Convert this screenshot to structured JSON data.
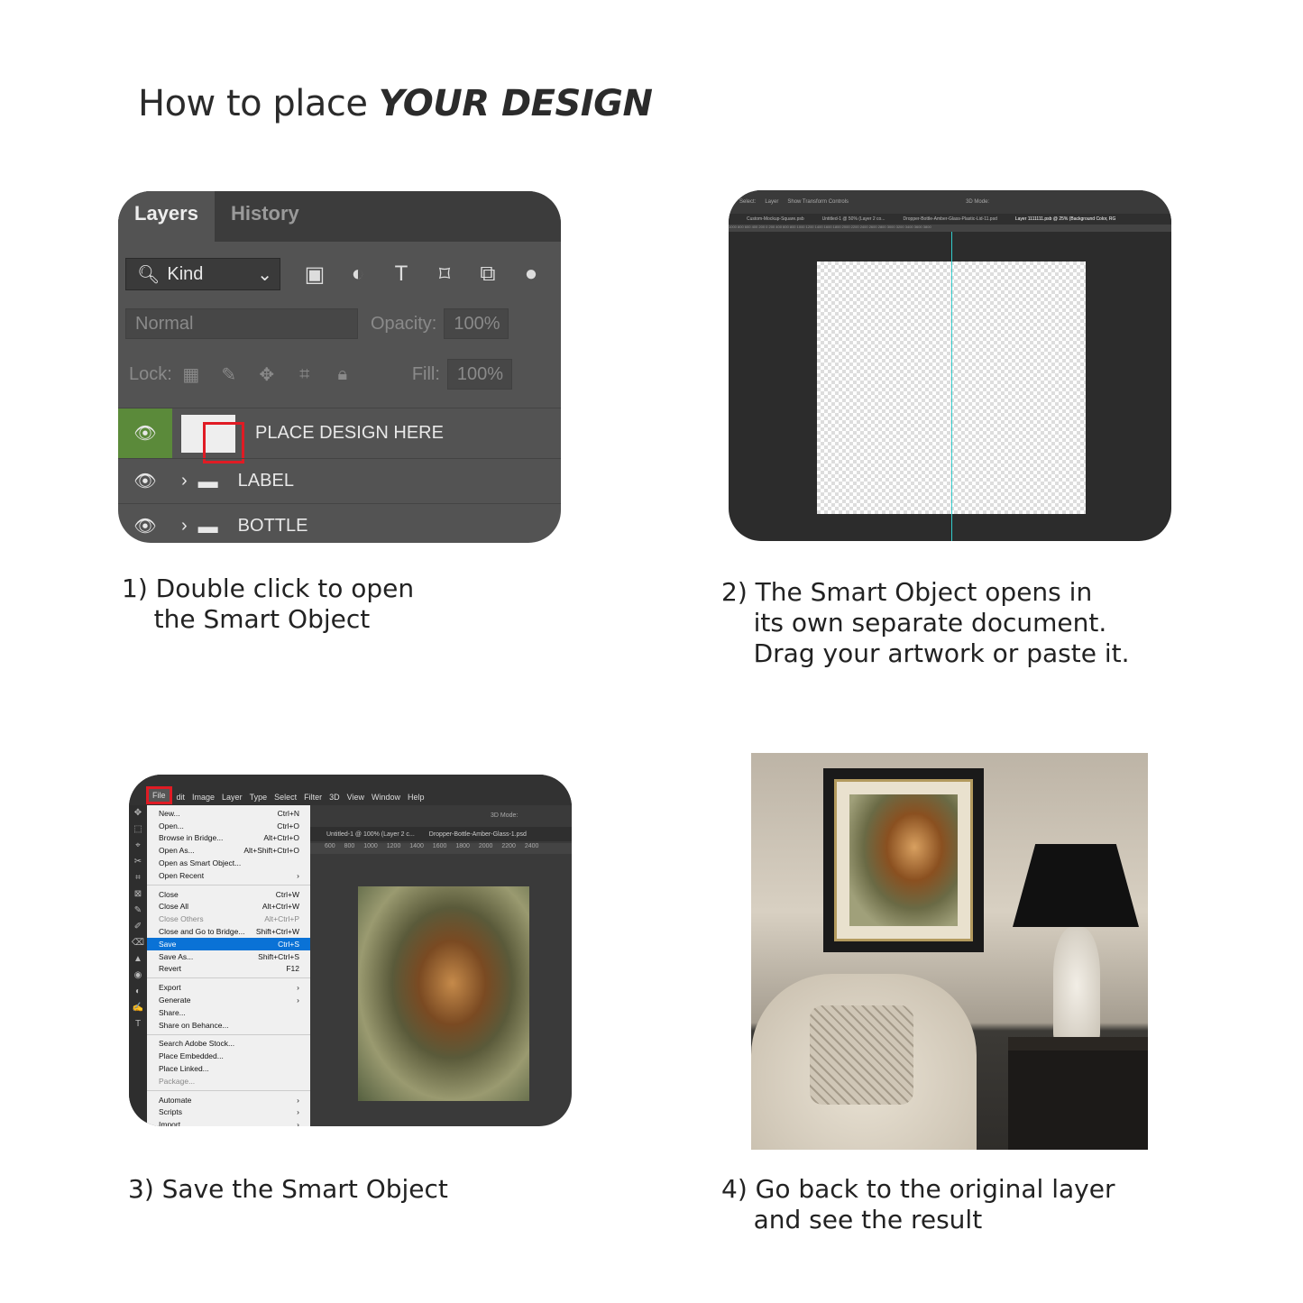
{
  "title": {
    "normal": "How to place ",
    "bold": "YOUR DESIGN"
  },
  "step1": {
    "caption": "1) Double click to open\n    the Smart Object",
    "tabs": [
      "Layers",
      "History"
    ],
    "filter_kind": "Kind",
    "blend_mode": "Normal",
    "opacity_label": "Opacity:",
    "opacity_value": "100%",
    "lock_label": "Lock:",
    "fill_label": "Fill:",
    "fill_value": "100%",
    "layers": [
      {
        "name": "PLACE DESIGN HERE",
        "type": "smart-object",
        "selected": true
      },
      {
        "name": "LABEL",
        "type": "group"
      },
      {
        "name": "BOTTLE",
        "type": "group"
      }
    ],
    "highlight_color": "#e01b24",
    "selected_eye_color": "#5b8a3a"
  },
  "step2": {
    "caption": "2) The Smart Object opens in\n    its own separate document.\n    Drag your artwork or paste it.",
    "options_bar": {
      "select_label": "Select:",
      "select_value": "Layer",
      "transform": "Show Transform Controls",
      "mode": "3D Mode:"
    },
    "doc_tabs": [
      "Custom-Mockup-Square.psb",
      "Untitled-1 @ 50% (Layer 2 co...",
      "Dropper-Bottle-Amber-Glass-Plastic-Lid-11.psd",
      "Layer 1111111.psb @ 25% (Background Color, RG"
    ],
    "ruler": "1000 800 600 400 200 0 200 400 600 800 1000 1200 1400 1600 1800 2000 2200 2400 2600 2800 3000 3200 3400 3600 3800"
  },
  "step3": {
    "caption": "3) Save the Smart Object",
    "menubar": [
      "File",
      "dit",
      "Image",
      "Layer",
      "Type",
      "Select",
      "Filter",
      "3D",
      "View",
      "Window",
      "Help"
    ],
    "menu_groups": [
      [
        {
          "label": "New...",
          "shortcut": "Ctrl+N"
        },
        {
          "label": "Open...",
          "shortcut": "Ctrl+O"
        },
        {
          "label": "Browse in Bridge...",
          "shortcut": "Alt+Ctrl+O"
        },
        {
          "label": "Open As...",
          "shortcut": "Alt+Shift+Ctrl+O"
        },
        {
          "label": "Open as Smart Object...",
          "shortcut": ""
        },
        {
          "label": "Open Recent",
          "shortcut": "›"
        }
      ],
      [
        {
          "label": "Close",
          "shortcut": "Ctrl+W"
        },
        {
          "label": "Close All",
          "shortcut": "Alt+Ctrl+W"
        },
        {
          "label": "Close Others",
          "shortcut": "Alt+Ctrl+P",
          "disabled": true
        },
        {
          "label": "Close and Go to Bridge...",
          "shortcut": "Shift+Ctrl+W"
        },
        {
          "label": "Save",
          "shortcut": "Ctrl+S",
          "selected": true
        },
        {
          "label": "Save As...",
          "shortcut": "Shift+Ctrl+S"
        },
        {
          "label": "Revert",
          "shortcut": "F12"
        }
      ],
      [
        {
          "label": "Export",
          "shortcut": "›"
        },
        {
          "label": "Generate",
          "shortcut": "›"
        },
        {
          "label": "Share...",
          "shortcut": ""
        },
        {
          "label": "Share on Behance...",
          "shortcut": ""
        }
      ],
      [
        {
          "label": "Search Adobe Stock...",
          "shortcut": ""
        },
        {
          "label": "Place Embedded...",
          "shortcut": ""
        },
        {
          "label": "Place Linked...",
          "shortcut": ""
        },
        {
          "label": "Package...",
          "shortcut": "",
          "disabled": true
        }
      ],
      [
        {
          "label": "Automate",
          "shortcut": "›"
        },
        {
          "label": "Scripts",
          "shortcut": "›"
        },
        {
          "label": "Import",
          "shortcut": "›"
        }
      ]
    ],
    "options_mode": "3D Mode:",
    "doc_tabs": [
      "Untitled-1 @ 100% (Layer 2 c...",
      "Dropper-Bottle-Amber-Glass-1.psd"
    ],
    "ruler": "600 800 1000 1200 1400 1600 1800 2000 2200 2400",
    "selection_color": "#0a72d6"
  },
  "step4": {
    "caption": "4) Go back to the original layer\n    and see the result"
  }
}
